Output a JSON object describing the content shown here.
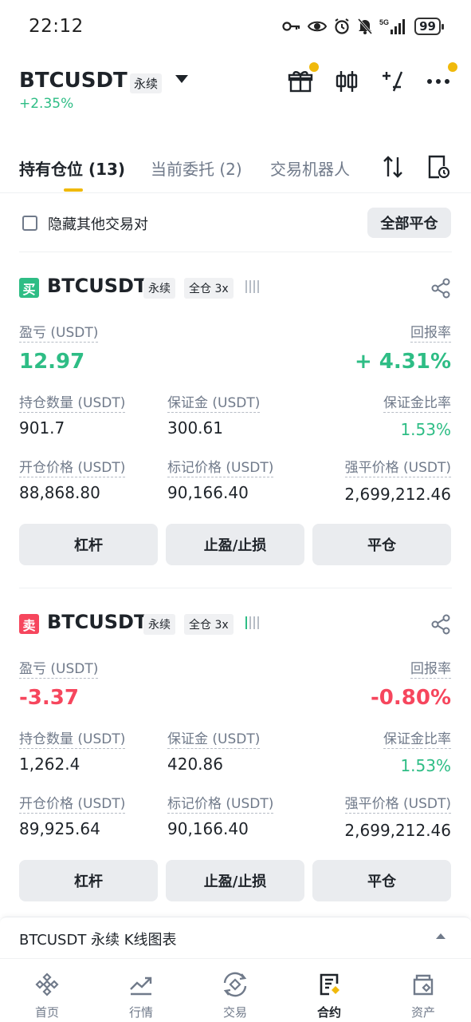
{
  "status_bar": {
    "time": "22:12",
    "battery": "99",
    "icons": [
      "key-icon",
      "eye-icon",
      "alarm-icon",
      "mute-icon",
      "signal-5g-icon",
      "battery-icon"
    ],
    "network": "5G"
  },
  "header": {
    "symbol": "BTCUSDT",
    "tag": "永续",
    "change": "+2.35%",
    "icons": [
      "gift-icon",
      "candlestick-icon",
      "calculator-icon",
      "more-icon"
    ]
  },
  "tabs": [
    {
      "label": "持有仓位 (13)",
      "active": true
    },
    {
      "label": "当前委托 (2)",
      "active": false
    },
    {
      "label": "交易机器人",
      "active": false
    }
  ],
  "filter": {
    "hide_label": "隐藏其他交易对",
    "close_all": "全部平仓"
  },
  "positions": [
    {
      "side": "买",
      "side_type": "buy",
      "symbol": "BTCUSDT",
      "contract": "永续",
      "margin_mode": "全仓 3x",
      "pnl_label": "盈亏",
      "pnl_unit": "(USDT)",
      "pnl": "12.97",
      "roe_label": "回报率",
      "roe": "+ 4.31%",
      "size_label": "持仓数量",
      "size_unit": "(USDT)",
      "size": "901.7",
      "margin_label": "保证金",
      "margin_unit": "(USDT)",
      "margin": "300.61",
      "margin_ratio_label": "保证金比率",
      "margin_ratio": "1.53%",
      "entry_label": "开仓价格",
      "entry_unit": "(USDT)",
      "entry": "88,868.80",
      "mark_label": "标记价格",
      "mark_unit": "(USDT)",
      "mark": "90,166.40",
      "liq_label": "强平价格",
      "liq_unit": "(USDT)",
      "liq": "2,699,212.46",
      "buttons": [
        "杠杆",
        "止盈/止损",
        "平仓"
      ]
    },
    {
      "side": "卖",
      "side_type": "sell",
      "symbol": "BTCUSDT",
      "contract": "永续",
      "margin_mode": "全仓 3x",
      "pnl_label": "盈亏",
      "pnl_unit": "(USDT)",
      "pnl": "-3.37",
      "roe_label": "回报率",
      "roe": "-0.80%",
      "size_label": "持仓数量",
      "size_unit": "(USDT)",
      "size": "1,262.4",
      "margin_label": "保证金",
      "margin_unit": "(USDT)",
      "margin": "420.86",
      "margin_ratio_label": "保证金比率",
      "margin_ratio": "1.53%",
      "entry_label": "开仓价格",
      "entry_unit": "(USDT)",
      "entry": "89,925.64",
      "mark_label": "标记价格",
      "mark_unit": "(USDT)",
      "mark": "90,166.40",
      "liq_label": "强平价格",
      "liq_unit": "(USDT)",
      "liq": "2,699,212.46",
      "buttons": [
        "杠杆",
        "止盈/止损",
        "平仓"
      ]
    }
  ],
  "kline": {
    "label": "BTCUSDT 永续 K线图表"
  },
  "bottom_nav": [
    {
      "label": "首页",
      "icon": "home-icon",
      "active": false
    },
    {
      "label": "行情",
      "icon": "markets-icon",
      "active": false
    },
    {
      "label": "交易",
      "icon": "trade-icon",
      "active": false
    },
    {
      "label": "合约",
      "icon": "futures-icon",
      "active": true
    },
    {
      "label": "资产",
      "icon": "wallet-icon",
      "active": false
    }
  ],
  "colors": {
    "accent": "#f0b90b",
    "buy": "#2ebd85",
    "sell": "#f6465d",
    "text": "#1e2329",
    "muted": "#707a8a"
  }
}
